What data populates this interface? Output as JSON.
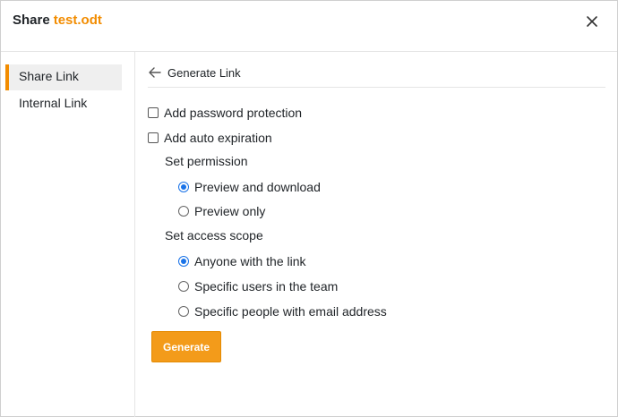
{
  "header": {
    "title_prefix": "Share",
    "filename": "test.odt"
  },
  "sidebar": {
    "items": [
      {
        "label": "Share Link",
        "active": true
      },
      {
        "label": "Internal Link",
        "active": false
      }
    ]
  },
  "panel": {
    "back_label": "Generate Link",
    "options": {
      "password_label": "Add password protection",
      "password_checked": false,
      "expiration_label": "Add auto expiration",
      "expiration_checked": false
    },
    "permission": {
      "label": "Set permission",
      "choices": [
        {
          "label": "Preview and download",
          "checked": true
        },
        {
          "label": "Preview only",
          "checked": false
        }
      ]
    },
    "scope": {
      "label": "Set access scope",
      "choices": [
        {
          "label": "Anyone with the link",
          "checked": true
        },
        {
          "label": "Specific users in the team",
          "checked": false
        },
        {
          "label": "Specific people with email address",
          "checked": false
        }
      ]
    },
    "generate_label": "Generate"
  },
  "colors": {
    "accent": "#f28c00",
    "radio_selected": "#1a73e8"
  },
  "icons": {
    "close": "close-icon",
    "back": "arrow-left-icon"
  }
}
